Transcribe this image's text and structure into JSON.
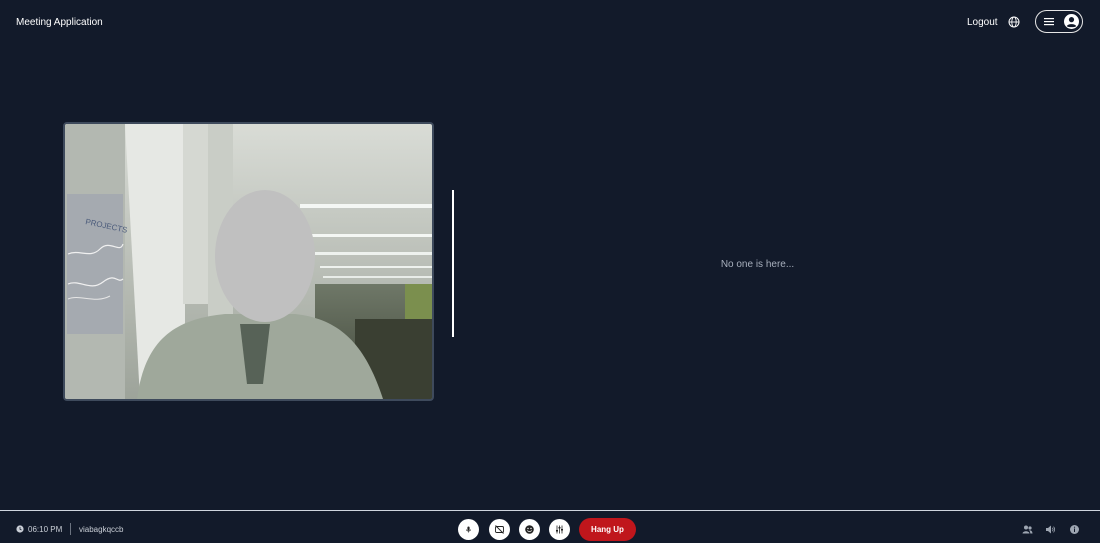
{
  "header": {
    "app_title": "Meeting Application",
    "logout_label": "Logout",
    "globe_icon": "globe-icon",
    "menu_icon": "hamburger-icon",
    "avatar_icon": "user-avatar-icon"
  },
  "video": {
    "face_blurred": true
  },
  "main": {
    "empty_message": "No one is here..."
  },
  "footer": {
    "time": "06:10 PM",
    "meeting_id": "viabagkqccb",
    "controls": [
      {
        "name": "microphone-button",
        "icon": "microphone-icon"
      },
      {
        "name": "camera-off-button",
        "icon": "camera-off-icon"
      },
      {
        "name": "emoji-button",
        "icon": "smile-icon"
      },
      {
        "name": "settings-button",
        "icon": "sliders-icon"
      }
    ],
    "hangup_label": "Hang Up",
    "right_icons": [
      "participants-icon",
      "speaker-icon",
      "info-icon"
    ]
  },
  "colors": {
    "background": "#121a2a",
    "hangup": "#c0161c",
    "muted_text": "#a8b0bd"
  }
}
